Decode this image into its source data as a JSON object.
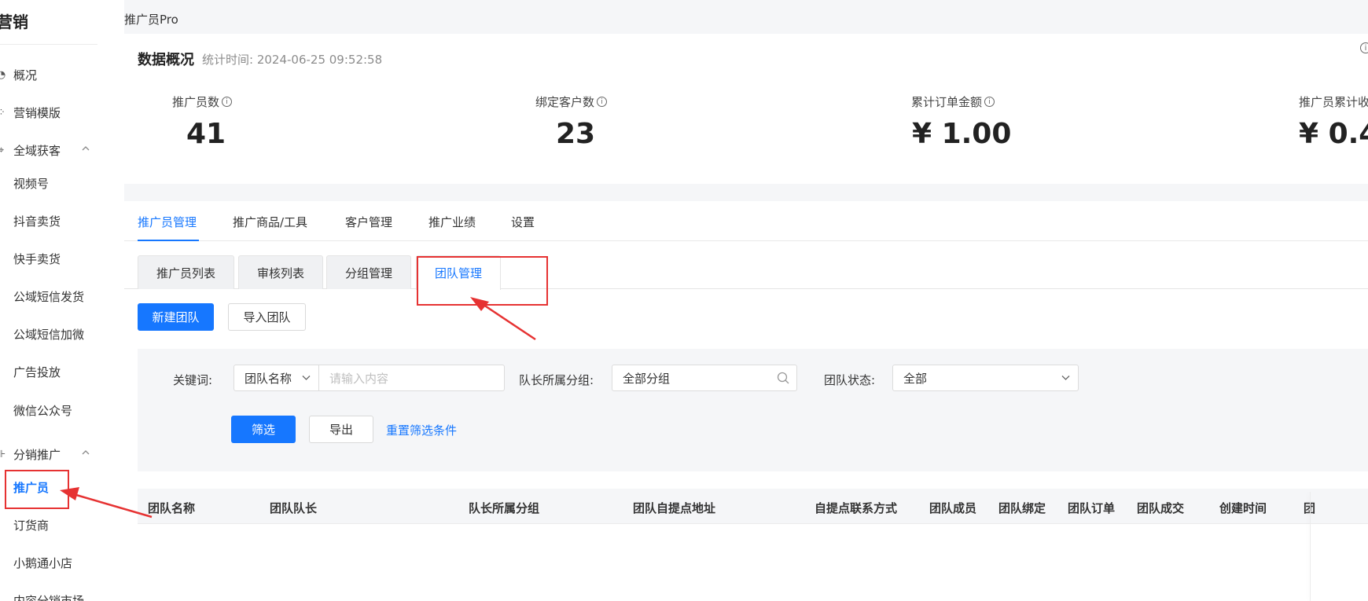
{
  "sidebar": {
    "title": "营销",
    "items": [
      {
        "label": "概况",
        "icon": "overview-icon"
      },
      {
        "label": "营销模版",
        "icon": "template-icon"
      },
      {
        "label": "全域获客",
        "icon": "acquire-icon",
        "expanded": true
      },
      {
        "label": "视频号"
      },
      {
        "label": "抖音卖货"
      },
      {
        "label": "快手卖货"
      },
      {
        "label": "公域短信发货"
      },
      {
        "label": "公域短信加微"
      },
      {
        "label": "广告投放"
      },
      {
        "label": "微信公众号"
      },
      {
        "label": "分销推广",
        "icon": "distribution-icon",
        "expanded": true
      },
      {
        "label": "推广员",
        "active": true
      },
      {
        "label": "订货商"
      },
      {
        "label": "小鹅通小店"
      },
      {
        "label": "内容分销市场"
      }
    ]
  },
  "breadcrumb": "推广员Pro",
  "overview": {
    "title": "数据概况",
    "time": "统计时间: 2024-06-25 09:52:58",
    "stats": [
      {
        "label": "推广员数",
        "value": "41"
      },
      {
        "label": "绑定客户数",
        "value": "23"
      },
      {
        "label": "累计订单金额",
        "value": "¥ 1.00"
      },
      {
        "label": "推广员累计收",
        "value": "¥ 0.4"
      }
    ]
  },
  "tabs": [
    "推广员管理",
    "推广商品/工具",
    "客户管理",
    "推广业绩",
    "设置"
  ],
  "active_tab": "推广员管理",
  "subtabs": [
    "推广员列表",
    "审核列表",
    "分组管理",
    "团队管理"
  ],
  "active_subtab": "团队管理",
  "actions": {
    "create": "新建团队",
    "import": "导入团队"
  },
  "filter": {
    "keyword_label": "关键词:",
    "keyword_type": "团队名称",
    "keyword_placeholder": "请输入内容",
    "group_label": "队长所属分组:",
    "group_value": "全部分组",
    "status_label": "团队状态:",
    "status_value": "全部",
    "filter_btn": "筛选",
    "export_btn": "导出",
    "reset_link": "重置筛选条件"
  },
  "table": {
    "columns": [
      "团队名称",
      "团队队长",
      "队长所属分组",
      "团队自提点地址",
      "自提点联系方式",
      "团队成员",
      "团队绑定",
      "团队订单",
      "团队成交",
      "创建时间",
      "团"
    ]
  },
  "colors": {
    "accent": "#1677ff",
    "callout": "#e63232"
  }
}
